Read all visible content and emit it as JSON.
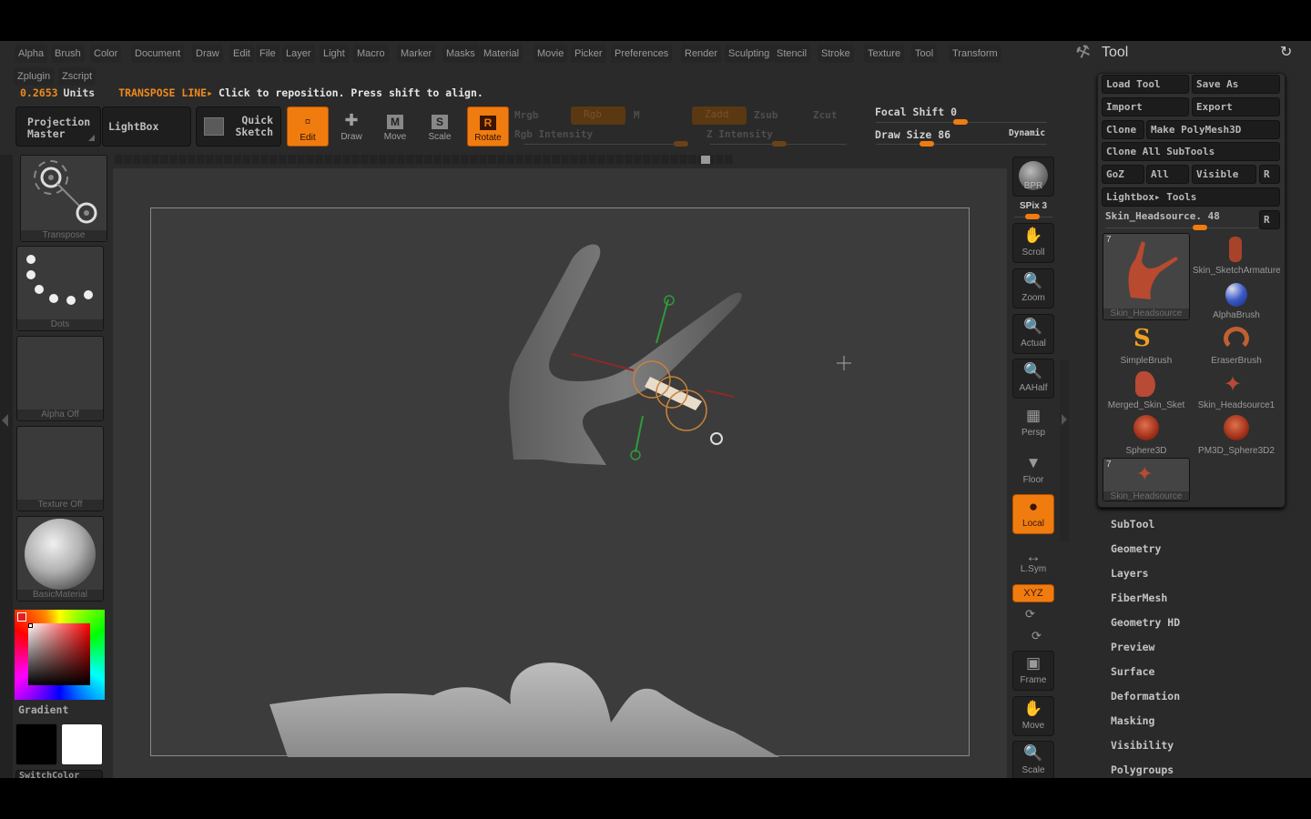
{
  "menu": {
    "row1": [
      "Alpha",
      "Brush",
      "Color",
      "Document",
      "Draw",
      "Edit",
      "File",
      "Layer",
      "Light",
      "Macro",
      "Marker",
      "Masks",
      "Material",
      "Movie",
      "Picker",
      "Preferences",
      "Render",
      "Sculpting",
      "Stencil",
      "Stroke",
      "Texture",
      "Tool",
      "Transform"
    ],
    "row2": [
      "Zplugin",
      "Zscript"
    ]
  },
  "status": {
    "units_value": "0.2653",
    "units_label": "Units",
    "mode": "TRANSPOSE LINE▸",
    "message": "Click to reposition. Press shift to align."
  },
  "shelf": {
    "projection_master": [
      "Projection",
      "Master"
    ],
    "lightbox": "LightBox",
    "quick_sketch": [
      "Quick",
      "Sketch"
    ],
    "modes": [
      {
        "label": "Edit",
        "active": true
      },
      {
        "label": "Draw",
        "active": false
      },
      {
        "label": "Move",
        "active": false
      },
      {
        "label": "Scale",
        "active": false
      },
      {
        "label": "Rotate",
        "active": true
      }
    ],
    "mrgb": "Mrgb",
    "rgb": "Rgb",
    "m": "M",
    "zadd": "Zadd",
    "zsub": "Zsub",
    "zcut": "Zcut",
    "rgb_intensity": "Rgb  Intensity",
    "z_intensity": "Z  Intensity",
    "focal_shift_label": "Focal  Shift",
    "focal_shift_value": "0",
    "draw_size_label": "Draw  Size",
    "draw_size_value": "86",
    "dynamic": "Dynamic"
  },
  "left_panel": {
    "brush": "Transpose",
    "stroke": "Dots",
    "alpha": "Alpha  Off",
    "texture": "Texture  Off",
    "material": "BasicMaterial",
    "gradient": "Gradient",
    "switch_color": "SwitchColor",
    "colors": {
      "primary": "#000000",
      "secondary": "#ffffff",
      "picker_selected": "#e02020"
    }
  },
  "right_toolbar": {
    "bpr": "BPR",
    "spix": "SPix 3",
    "buttons": [
      "Scroll",
      "Zoom",
      "Actual",
      "AAHalf",
      "Persp",
      "Floor",
      "Local",
      "L.Sym",
      "XYZ",
      "Frame",
      "Move",
      "Scale"
    ],
    "active": [
      "Local",
      "XYZ"
    ]
  },
  "tool_panel": {
    "title": "Tool",
    "load_tool": "Load Tool",
    "save_as": "Save As",
    "import": "Import",
    "export": "Export",
    "clone": "Clone",
    "make_polymesh": "Make PolyMesh3D",
    "clone_all": "Clone  All  SubTools",
    "goz": "GoZ",
    "all": "All",
    "visible": "Visible",
    "r": "R",
    "lightbox_tools": "Lightbox▸ Tools",
    "current_tool": "Skin_Headsource. 48",
    "current_slider": 0.62,
    "tools": [
      {
        "name": "Skin_Headsource",
        "count": "7",
        "selected": true
      },
      {
        "name": "Skin_SketchArmature",
        "count": "",
        "selected": false
      },
      {
        "name": "AlphaBrush",
        "count": "",
        "selected": false
      },
      {
        "name": "SimpleBrush",
        "count": "",
        "selected": false
      },
      {
        "name": "EraserBrush",
        "count": "",
        "selected": false
      },
      {
        "name": "Merged_Skin_Sket",
        "count": "",
        "selected": false
      },
      {
        "name": "Skin_Headsource1",
        "count": "",
        "selected": false
      },
      {
        "name": "Sphere3D",
        "count": "",
        "selected": false
      },
      {
        "name": "PM3D_Sphere3D2",
        "count": "",
        "selected": false
      },
      {
        "name": "Skin_Headsource",
        "count": "7",
        "selected": true
      }
    ],
    "sections": [
      "SubTool",
      "Geometry",
      "Layers",
      "FiberMesh",
      "Geometry  HD",
      "Preview",
      "Surface",
      "Deformation",
      "Masking",
      "Visibility",
      "Polygroups"
    ]
  }
}
